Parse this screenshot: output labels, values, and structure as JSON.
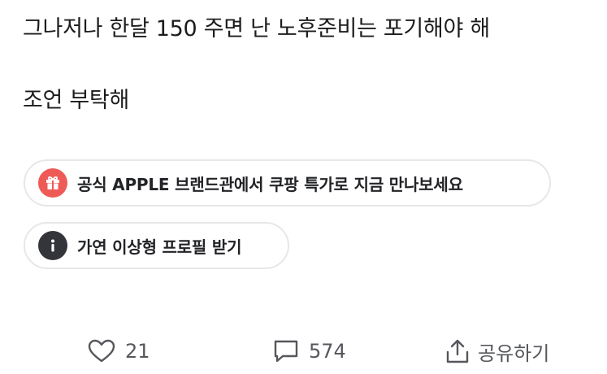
{
  "post": {
    "lines": [
      "그나저나 한달 150 주면 난 노후준비는 포기해야 해",
      "조언 부탁해"
    ]
  },
  "chips": {
    "ad": {
      "label": "공식 APPLE 브랜드관에서 쿠팡 특가로 지금 만나보세요",
      "icon": "gift-icon",
      "color": "#ee5b57"
    },
    "profile": {
      "label": "가연 이상형 프로필 받기",
      "icon": "info-icon",
      "color": "#33353a"
    }
  },
  "actions": {
    "like_count": "21",
    "comment_count": "574",
    "share_label": "공유하기"
  }
}
